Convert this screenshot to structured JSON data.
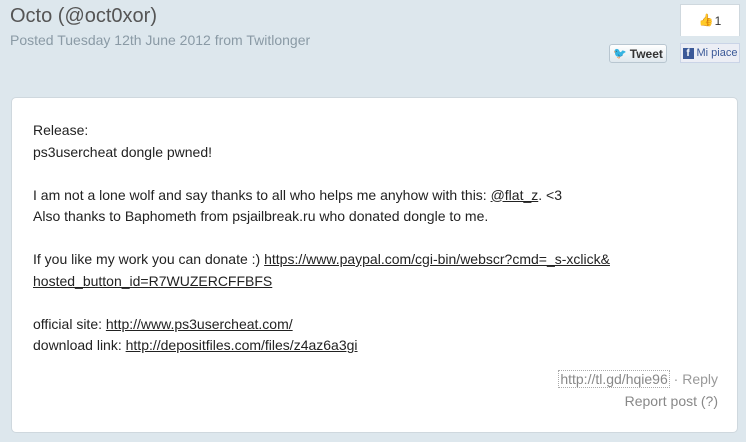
{
  "header": {
    "title": "Octo (@oct0xor)",
    "subtitle": "Posted Tuesday 12th June 2012 from Twitlonger"
  },
  "social": {
    "like_count": "1",
    "tweet_label": "Tweet",
    "fb_label": "Mi piace"
  },
  "post": {
    "line1": "Release:",
    "line2": "ps3usercheat dongle pwned!",
    "line3_prefix": "I am not a lone wolf and say thanks to all who helps me anyhow with this: ",
    "line3_mention": "@flat_z",
    "line3_suffix": ". <3",
    "line4": "Also thanks to Baphometh from psjailbreak.ru who donated dongle to me.",
    "line5_prefix": "If you like my work you can donate :) ",
    "donate_link_part1": "https://www.paypal.com/cgi-bin/webscr?cmd=_s-xclick&",
    "donate_link_part2": "hosted_button_id=R7WUZERCFFBFS",
    "site_prefix": "official site: ",
    "site_link": "http://www.ps3usercheat.com/",
    "download_prefix": "download link: ",
    "download_link": "http://depositfiles.com/files/z4az6a3gi"
  },
  "footer": {
    "short_link": "http://tl.gd/hqie96",
    "separator": " · ",
    "reply_label": "Reply",
    "report_label": "Report post (?)"
  }
}
